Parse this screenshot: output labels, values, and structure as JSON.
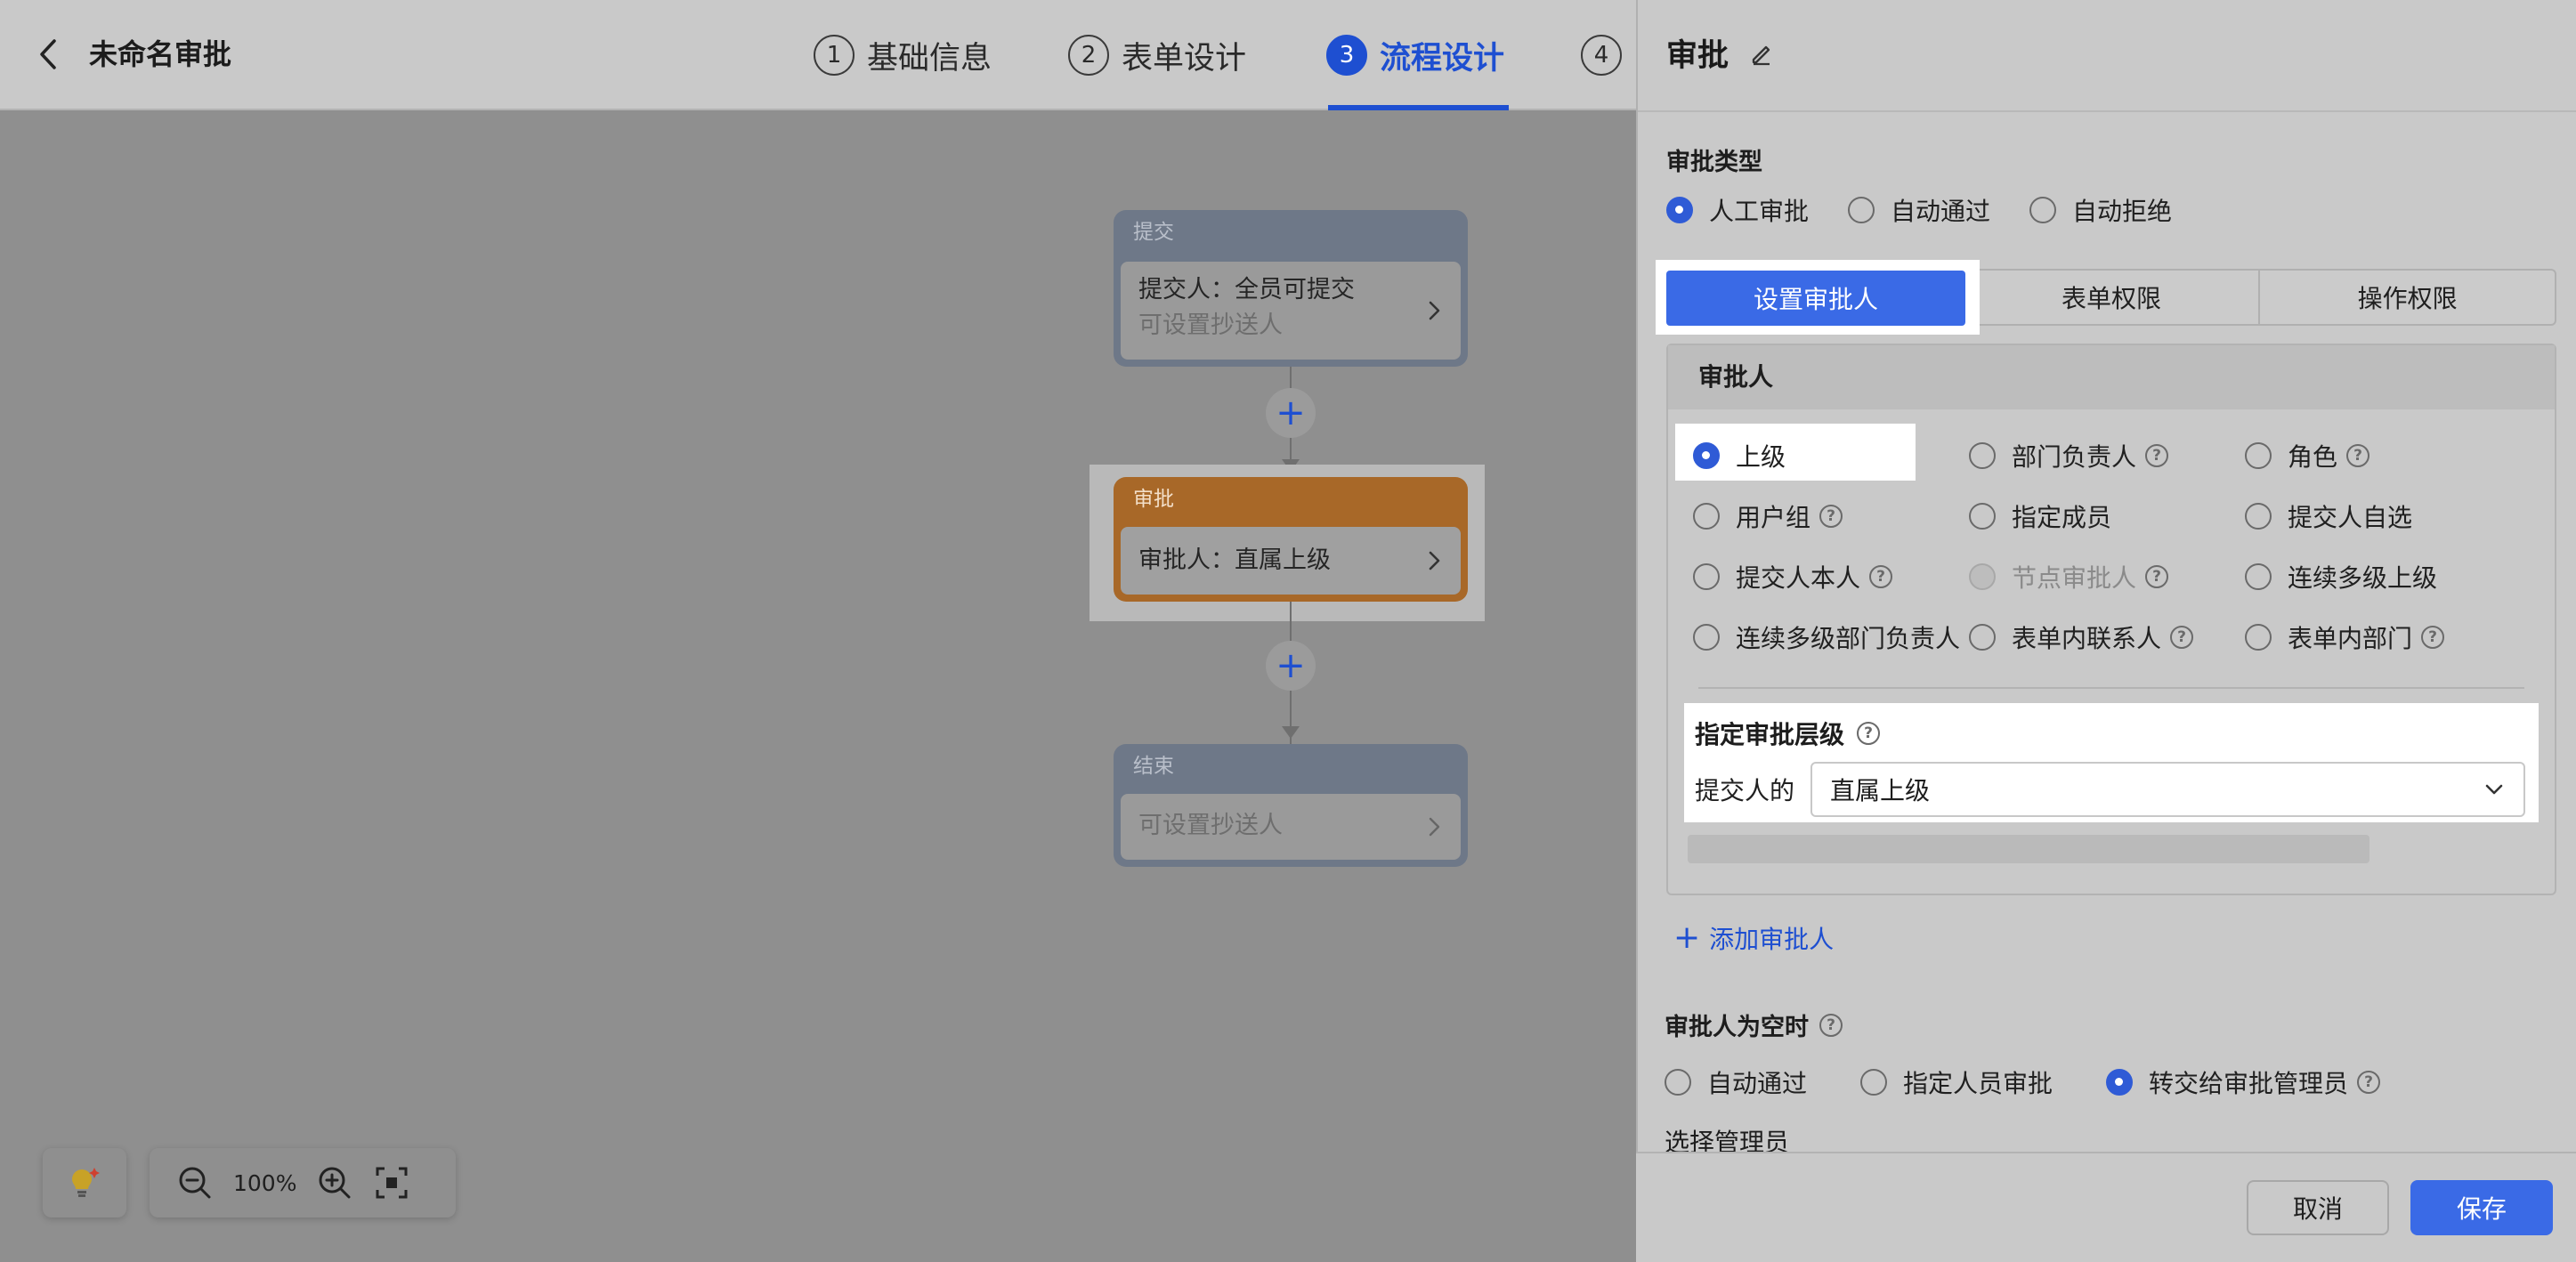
{
  "header": {
    "back_icon": "chevron-left-icon",
    "title": "未命名审批",
    "steps": [
      {
        "num": "1",
        "label": "基础信息"
      },
      {
        "num": "2",
        "label": "表单设计"
      },
      {
        "num": "3",
        "label": "流程设计"
      },
      {
        "num": "4",
        "label": ""
      }
    ],
    "active_step": 3,
    "accent_color": "#1e4fd1"
  },
  "flow": {
    "submit": {
      "title": "提交",
      "line1": "提交人：全员可提交",
      "line2": "可设置抄送人"
    },
    "approve": {
      "title": "审批",
      "line1": "审批人：直属上级"
    },
    "end": {
      "title": "结束",
      "line2": "可设置抄送人"
    },
    "add_symbol": "+"
  },
  "toolbar": {
    "zoom": "100%"
  },
  "panel": {
    "title": "审批",
    "edit_icon": "pencil-icon",
    "approval_type": {
      "label": "审批类型",
      "options": [
        "人工审批",
        "自动通过",
        "自动拒绝"
      ],
      "selected": 0
    },
    "tabs": [
      "设置审批人",
      "表单权限",
      "操作权限"
    ],
    "active_tab": 0,
    "approver": {
      "label": "审批人",
      "options": [
        "上级",
        "部门负责人",
        "角色",
        "用户组",
        "指定成员",
        "提交人自选",
        "提交人本人",
        "节点审批人",
        "连续多级上级",
        "连续多级部门负责人",
        "表单内联系人",
        "表单内部门"
      ],
      "selected": 0,
      "disabled_index": 7
    },
    "level": {
      "label": "指定审批层级",
      "prefix": "提交人的",
      "value": "直属上级"
    },
    "add_approver": "添加审批人",
    "empty_approver": {
      "label": "审批人为空时",
      "options": [
        "自动通过",
        "指定人员审批",
        "转交给审批管理员"
      ],
      "selected": 2
    },
    "select_admin": "选择管理员"
  },
  "footer": {
    "cancel": "取消",
    "save": "保存"
  }
}
